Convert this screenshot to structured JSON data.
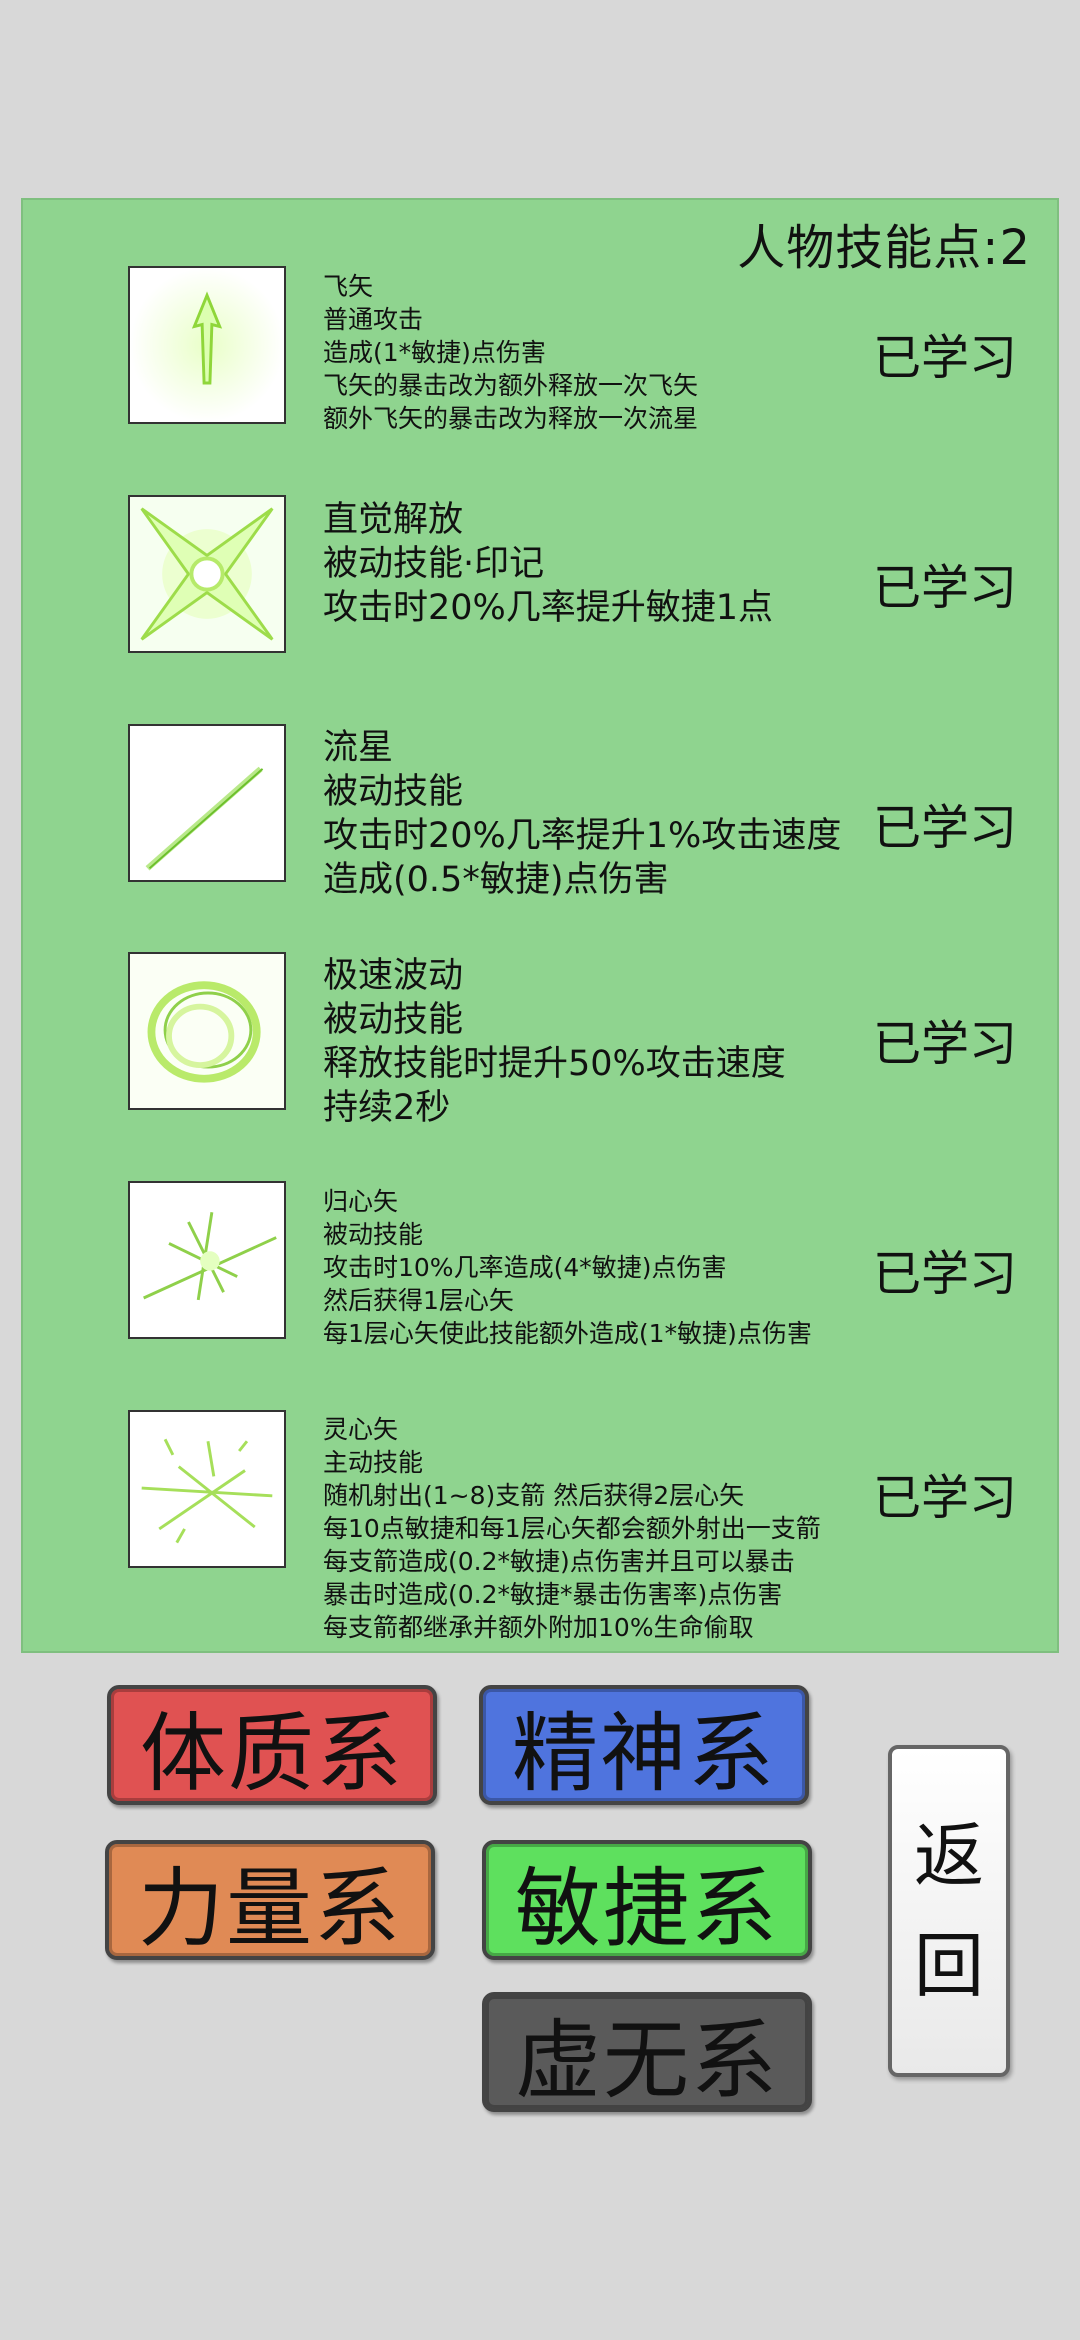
{
  "header": {
    "skill_points": "人物技能点:2"
  },
  "skills": [
    {
      "icon": "arrow-icon",
      "lines": [
        "飞矢",
        "普通攻击",
        "造成(1*敏捷)点伤害",
        "飞矢的暴击改为额外释放一次飞矢",
        "额外飞矢的暴击改为释放一次流星"
      ],
      "status": "已学习"
    },
    {
      "icon": "star-seal-icon",
      "lines": [
        "直觉解放",
        "被动技能·印记",
        "攻击时20%几率提升敏捷1点"
      ],
      "status": "已学习"
    },
    {
      "icon": "meteor-streak-icon",
      "lines": [
        "流星",
        "被动技能",
        "攻击时20%几率提升1%攻击速度",
        "造成(0.5*敏捷)点伤害"
      ],
      "status": "已学习"
    },
    {
      "icon": "wind-vortex-icon",
      "lines": [
        "极速波动",
        "被动技能",
        "释放技能时提升50%攻击速度",
        "持续2秒"
      ],
      "status": "已学习"
    },
    {
      "icon": "burst-arrows-icon",
      "lines": [
        "归心矢",
        "被动技能",
        "攻击时10%几率造成(4*敏捷)点伤害",
        "然后获得1层心矢",
        "每1层心矢使此技能额外造成(1*敏捷)点伤害"
      ],
      "status": "已学习"
    },
    {
      "icon": "scatter-arrows-icon",
      "lines": [
        "灵心矢",
        "主动技能",
        "随机射出(1~8)支箭 然后获得2层心矢",
        "每10点敏捷和每1层心矢都会额外射出一支箭",
        "每支箭造成(0.2*敏捷)点伤害并且可以暴击",
        "暴击时造成(0.2*敏捷*暴击伤害率)点伤害",
        "每支箭都继承并额外附加10%生命偷取"
      ],
      "status": "已学习"
    }
  ],
  "categories": {
    "constitution": {
      "label": "体质系",
      "color": "#e05252"
    },
    "spirit": {
      "label": "精神系",
      "color": "#4f74de"
    },
    "strength": {
      "label": "力量系",
      "color": "#e08a55"
    },
    "agility": {
      "label": "敏捷系",
      "color": "#5ee05e"
    },
    "void": {
      "label": "虚无系",
      "color": "#5a5a5a"
    }
  },
  "back": {
    "line1": "返",
    "line2": "回"
  }
}
